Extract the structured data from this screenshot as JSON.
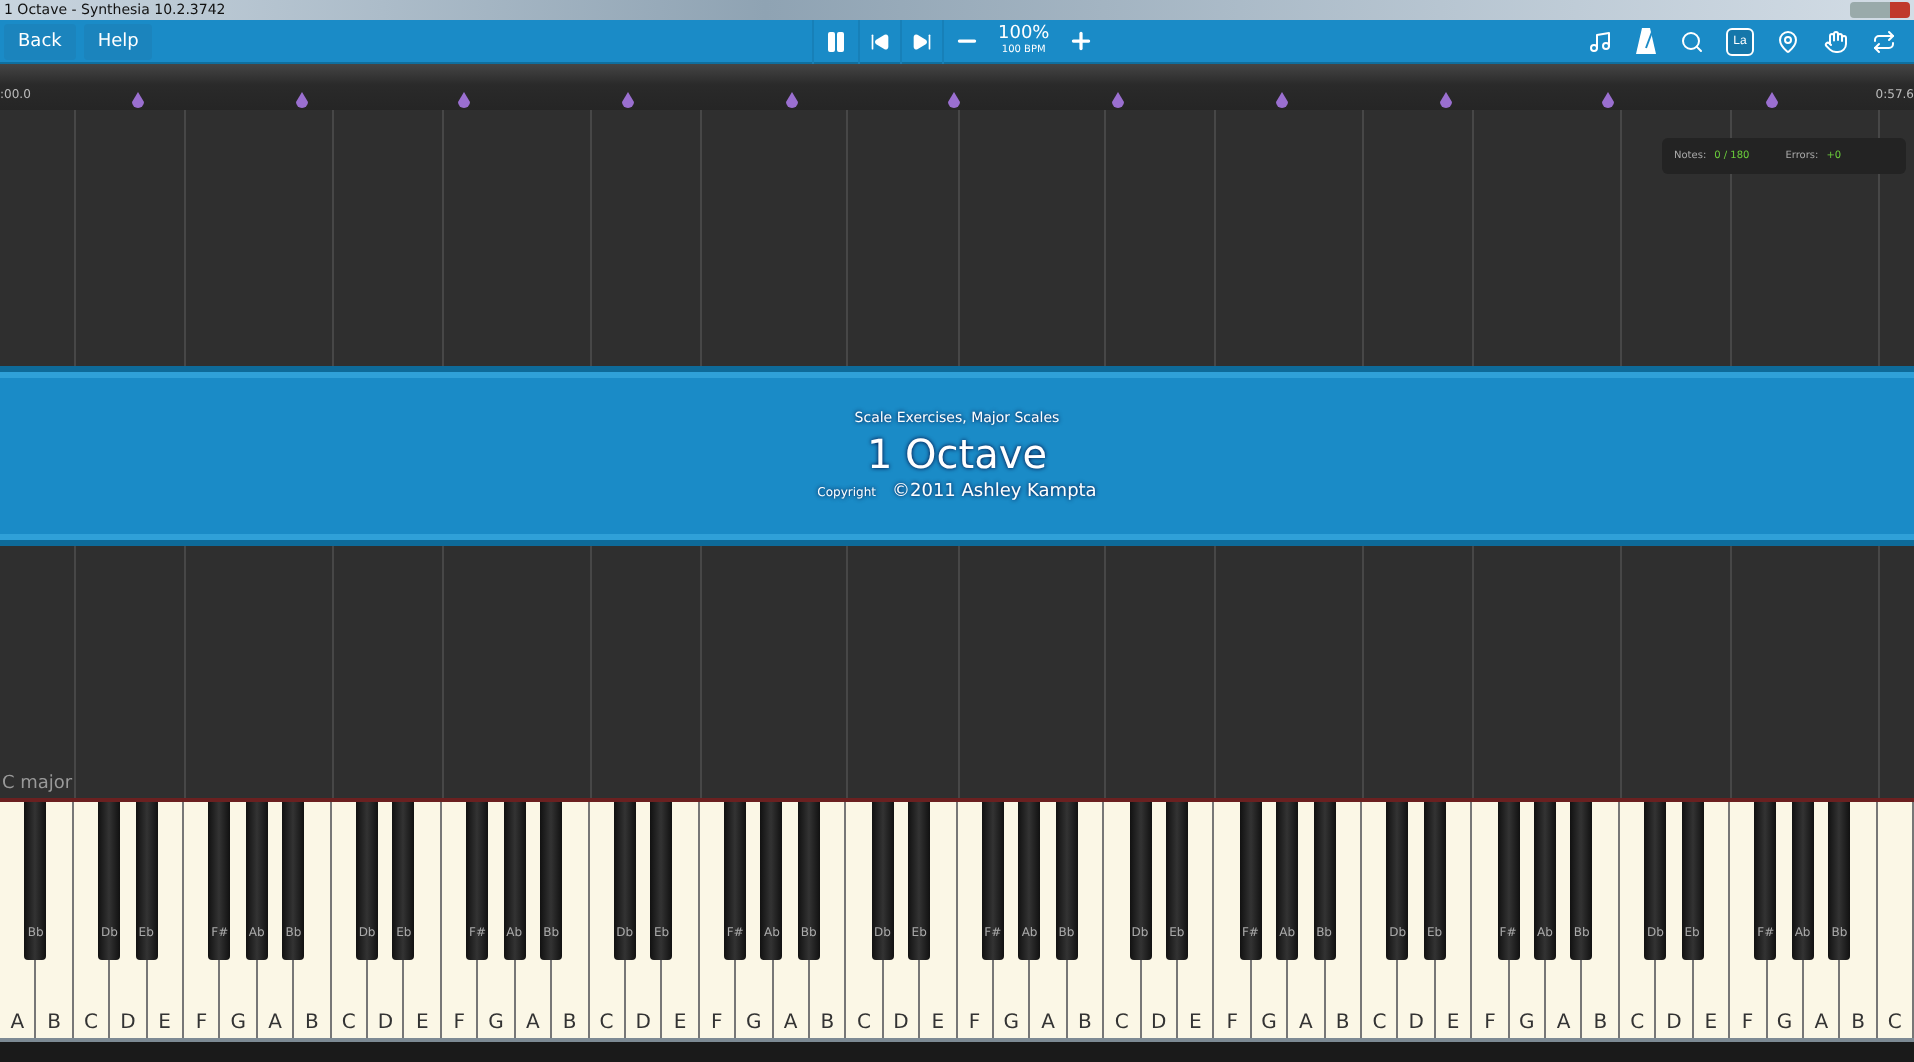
{
  "window": {
    "title": "1 Octave - Synthesia 10.2.3742"
  },
  "toolbar": {
    "left_buttons": [
      "Back",
      "Help"
    ],
    "speed": "100%",
    "tempo": "100 BPM",
    "right_tools": [
      {
        "kind": "note"
      },
      {
        "kind": "metronome"
      },
      {
        "kind": "search"
      },
      {
        "kind": "label",
        "text": "La"
      },
      {
        "kind": "pin"
      },
      {
        "kind": "hand"
      },
      {
        "kind": "loop"
      }
    ]
  },
  "timeline": {
    "start": ":00.0",
    "end": "0:57.6"
  },
  "stats": {
    "notes_label": "Notes:",
    "notes_value": "0 / 180",
    "errors_label": "Errors:",
    "errors_value": "+0"
  },
  "banner": {
    "subtitle": "Scale Exercises, Major Scales",
    "title": "1 Octave",
    "copyright_label": "Copyright",
    "copyright": "©2011 Ashley Kampta"
  },
  "key_signature": "C major",
  "keys": [
    {
      "label": "A",
      "black": "Bb"
    },
    {
      "label": "B"
    },
    {
      "label": "C",
      "black": "Db"
    },
    {
      "label": "D",
      "black": "Eb"
    },
    {
      "label": "E"
    },
    {
      "label": "F",
      "black": "F#"
    },
    {
      "label": "G",
      "black": "Ab"
    },
    {
      "label": "A",
      "black": "Bb"
    },
    {
      "label": "B"
    },
    {
      "label": "C",
      "black": "Db"
    },
    {
      "label": "D",
      "black": "Eb"
    },
    {
      "label": "E"
    },
    {
      "label": "F",
      "black": "F#"
    },
    {
      "label": "G",
      "black": "Ab"
    },
    {
      "label": "A",
      "black": "Bb"
    },
    {
      "label": "B"
    },
    {
      "label": "C",
      "black": "Db"
    },
    {
      "label": "D",
      "black": "Eb"
    },
    {
      "label": "E"
    },
    {
      "label": "F",
      "black": "F#"
    },
    {
      "label": "G",
      "black": "Ab"
    },
    {
      "label": "A",
      "black": "Bb"
    },
    {
      "label": "B"
    },
    {
      "label": "C",
      "black": "Db"
    },
    {
      "label": "D",
      "black": "Eb"
    },
    {
      "label": "E"
    },
    {
      "label": "F",
      "black": "F#"
    },
    {
      "label": "G",
      "black": "Ab"
    },
    {
      "label": "A",
      "black": "Bb"
    },
    {
      "label": "B"
    },
    {
      "label": "C",
      "black": "Db"
    },
    {
      "label": "D",
      "black": "Eb"
    },
    {
      "label": "E"
    },
    {
      "label": "F",
      "black": "F#"
    },
    {
      "label": "G",
      "black": "Ab"
    },
    {
      "label": "A",
      "black": "Bb"
    },
    {
      "label": "B"
    },
    {
      "label": "C",
      "black": "Db"
    },
    {
      "label": "D",
      "black": "Eb"
    },
    {
      "label": "E"
    },
    {
      "label": "F",
      "black": "F#"
    },
    {
      "label": "G",
      "black": "Ab"
    },
    {
      "label": "A",
      "black": "Bb"
    },
    {
      "label": "B"
    },
    {
      "label": "C",
      "black": "Db"
    },
    {
      "label": "D",
      "black": "Eb"
    },
    {
      "label": "E"
    },
    {
      "label": "F",
      "black": "F#"
    },
    {
      "label": "G",
      "black": "Ab"
    },
    {
      "label": "A",
      "black": "Bb"
    },
    {
      "label": "B"
    },
    {
      "label": "C"
    }
  ]
}
